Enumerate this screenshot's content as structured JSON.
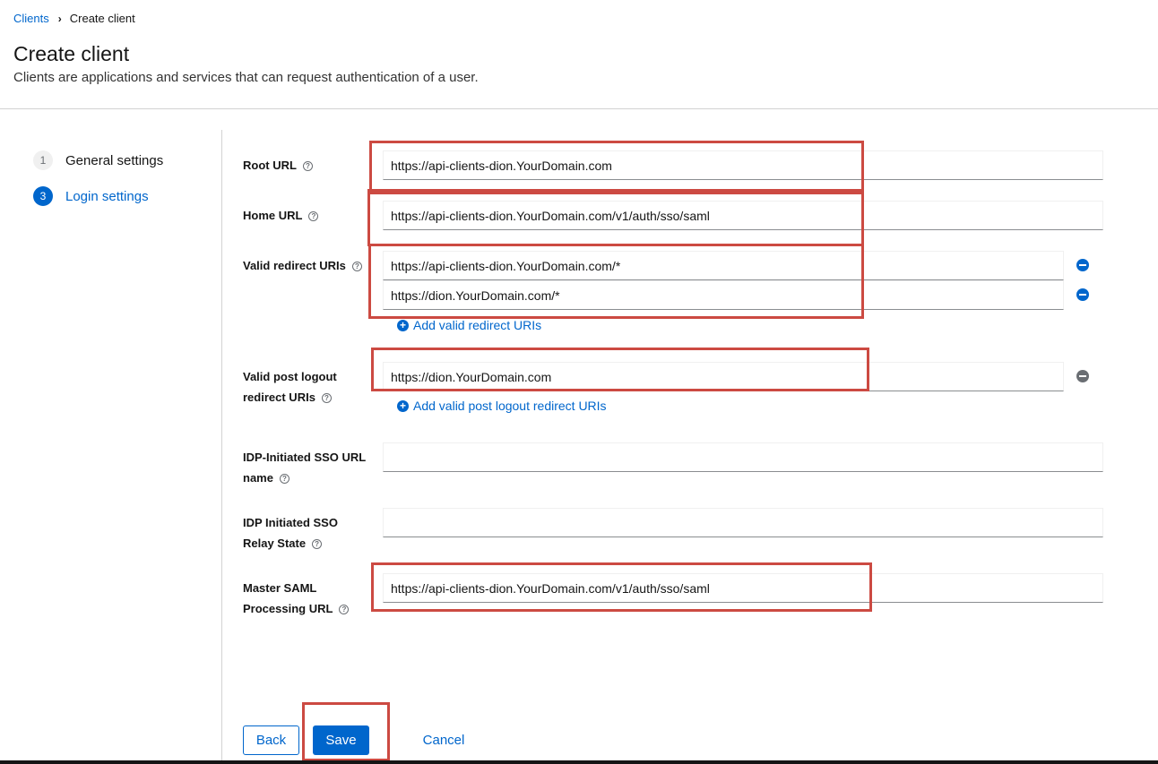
{
  "breadcrumb": {
    "parent": "Clients",
    "current": "Create client"
  },
  "header": {
    "title": "Create client",
    "subtitle": "Clients are applications and services that can request authentication of a user."
  },
  "steps": [
    {
      "number": "1",
      "label": "General settings",
      "active": false
    },
    {
      "number": "3",
      "label": "Login settings",
      "active": true
    }
  ],
  "form": {
    "root_url": {
      "label": "Root URL",
      "value": "https://api-clients-dion.YourDomain.com"
    },
    "home_url": {
      "label": "Home URL",
      "value": "https://api-clients-dion.YourDomain.com/v1/auth/sso/saml"
    },
    "valid_redirect_uris": {
      "label": "Valid redirect URIs",
      "values": [
        "https://api-clients-dion.YourDomain.com/*",
        "https://dion.YourDomain.com/*"
      ],
      "add_label": "Add valid redirect URIs"
    },
    "valid_post_logout": {
      "label_line1": "Valid post logout",
      "label_line2": "redirect URIs",
      "values": [
        "https://dion.YourDomain.com"
      ],
      "add_label": "Add valid post logout redirect URIs"
    },
    "idp_sso_url_name": {
      "label_line1": "IDP-Initiated SSO URL",
      "label_line2": "name",
      "value": ""
    },
    "idp_relay_state": {
      "label_line1": "IDP Initiated SSO",
      "label_line2": "Relay State",
      "value": ""
    },
    "master_saml": {
      "label_line1": "Master SAML",
      "label_line2": "Processing URL",
      "value": "https://api-clients-dion.YourDomain.com/v1/auth/sso/saml"
    }
  },
  "actions": {
    "back": "Back",
    "save": "Save",
    "cancel": "Cancel"
  },
  "colors": {
    "accent": "#0066cc",
    "highlight": "#cc4a42"
  },
  "icons": {
    "help": "?",
    "add": "+"
  }
}
